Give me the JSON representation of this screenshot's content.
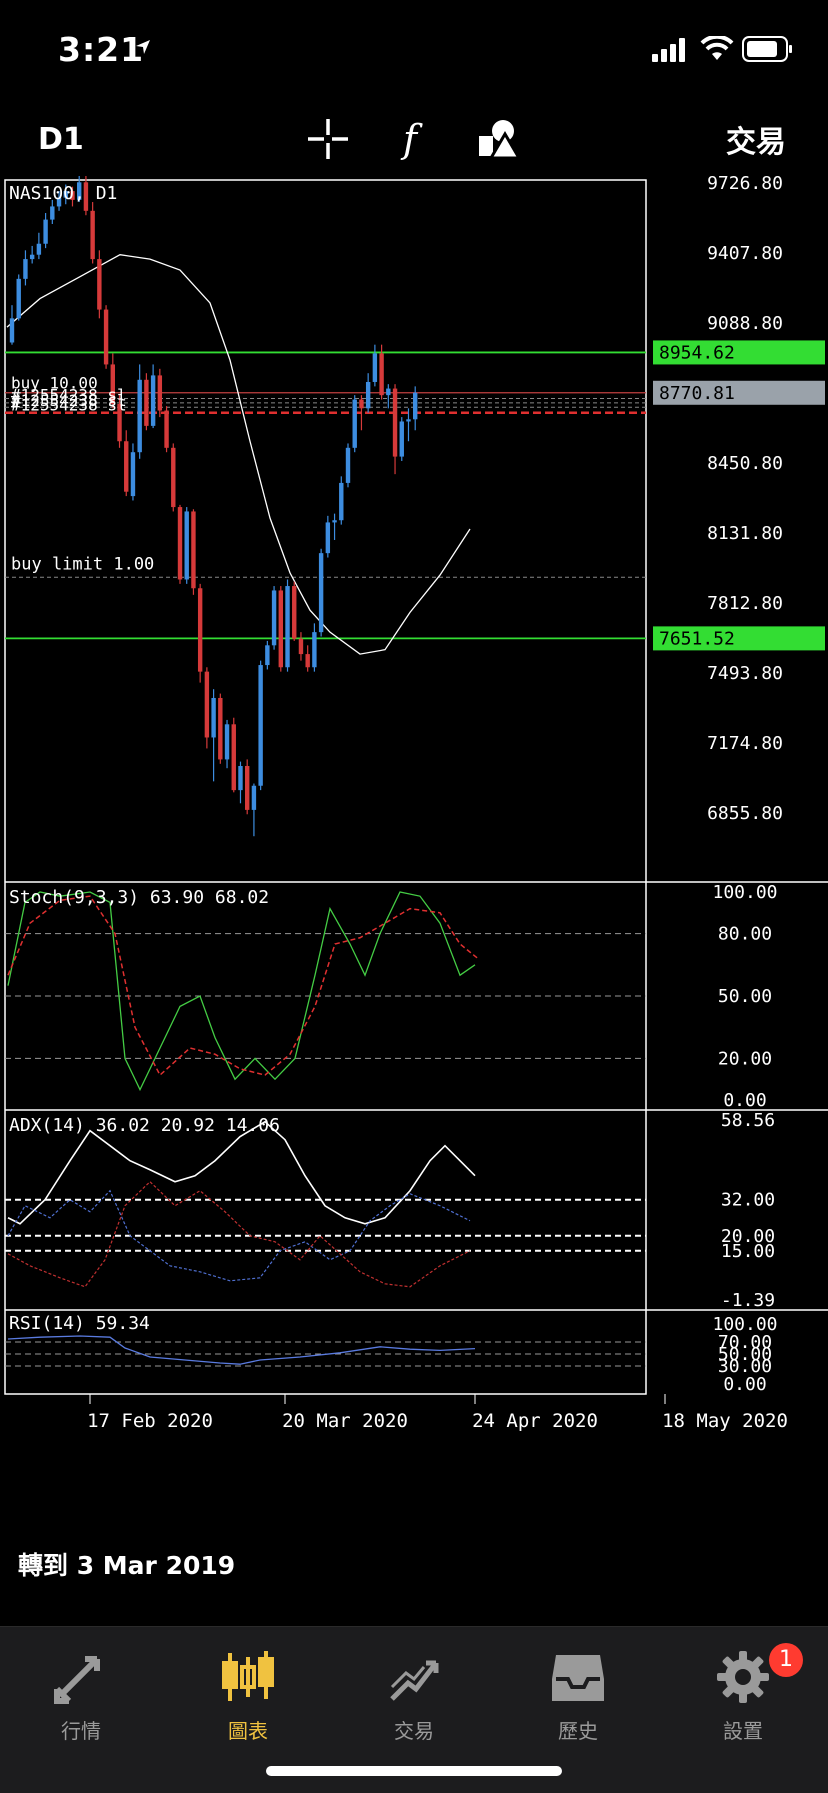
{
  "status_bar": {
    "time": "3:21"
  },
  "toolbar": {
    "timeframe": "D1",
    "trade_label": "交易"
  },
  "chart": {
    "main_title": "NAS100, D1",
    "price_ticks": [
      "9726.80",
      "9407.80",
      "9088.80",
      "8450.80",
      "8131.80",
      "7812.80",
      "7493.80",
      "7174.80",
      "6855.80"
    ],
    "level_tags": [
      {
        "text": "8954.62",
        "value": 8954.62,
        "bg": "#33dd33"
      },
      {
        "text": "8770.81",
        "value": 8770.81,
        "bg": "#9aa2aa"
      },
      {
        "text": "7651.52",
        "value": 7651.52,
        "bg": "#33dd33"
      }
    ],
    "order_labels": [
      "buy 10.00",
      "#12554238 sl",
      "buy limit 1.00"
    ],
    "buy_limit_price": 7930,
    "date_labels": [
      "17 Feb 2020",
      "20 Mar 2020",
      "24 Apr 2020",
      "18 May 2020"
    ],
    "stoch": {
      "title": "Stoch(9,3,3) 63.90 68.02",
      "ticks": [
        "100.00",
        "80.00",
        "50.00",
        "20.00",
        "0.00"
      ]
    },
    "adx": {
      "title": "ADX(14) 36.02 20.92 14.06",
      "ticks": [
        "58.56",
        "32.00",
        "20.00",
        "15.00",
        "-1.39"
      ]
    },
    "rsi": {
      "title": "RSI(14) 59.34",
      "ticks": [
        "100.00",
        "70.00",
        "50.00",
        "30.00",
        "0.00"
      ]
    },
    "jump_text": "轉到 3 Mar 2019",
    "colors": {
      "bull": "#3d8de0",
      "bear": "#d63a3a",
      "green_line": "#33dd33",
      "red_line": "#e03030"
    }
  },
  "tabs": [
    {
      "label": "行情",
      "icon": "quotes-icon"
    },
    {
      "label": "圖表",
      "icon": "chart-icon",
      "active": true
    },
    {
      "label": "交易",
      "icon": "trade-icon"
    },
    {
      "label": "歷史",
      "icon": "history-icon"
    },
    {
      "label": "設置",
      "icon": "settings-icon",
      "badge": "1"
    }
  ]
}
